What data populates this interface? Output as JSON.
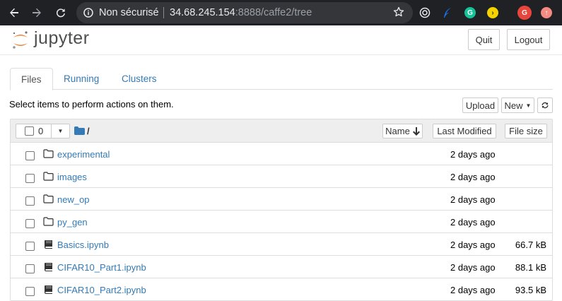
{
  "browser": {
    "security_label": "Non sécurisé",
    "url_host": "34.68.245.154",
    "url_rest": ":8888/caffe2/tree",
    "extensions": [
      {
        "name": "lens-icon",
        "color": "#5f6368",
        "text": ""
      },
      {
        "name": "feather-icon",
        "color": "#1a73e8",
        "text": ""
      },
      {
        "name": "grammarly-icon",
        "color": "#15c39a",
        "text": "G"
      },
      {
        "name": "yellow-ext-icon",
        "color": "#f4d300",
        "text": "›"
      },
      {
        "name": "profile-avatar",
        "color": "#e8453c",
        "text": "G"
      },
      {
        "name": "update-icon",
        "color": "#f28b82",
        "text": "↑"
      }
    ]
  },
  "header": {
    "logo_text": "jupyter",
    "quit_label": "Quit",
    "logout_label": "Logout"
  },
  "tabs": [
    {
      "label": "Files",
      "active": true
    },
    {
      "label": "Running",
      "active": false
    },
    {
      "label": "Clusters",
      "active": false
    }
  ],
  "toolbar": {
    "message": "Select items to perform actions on them.",
    "upload_label": "Upload",
    "new_label": "New"
  },
  "list_header": {
    "selected_count": "0",
    "path": "/",
    "name_label": "Name",
    "last_modified_label": "Last Modified",
    "file_size_label": "File size"
  },
  "files": [
    {
      "name": "experimental",
      "type": "folder",
      "modified": "2 days ago",
      "size": ""
    },
    {
      "name": "images",
      "type": "folder",
      "modified": "2 days ago",
      "size": ""
    },
    {
      "name": "new_op",
      "type": "folder",
      "modified": "2 days ago",
      "size": ""
    },
    {
      "name": "py_gen",
      "type": "folder",
      "modified": "2 days ago",
      "size": ""
    },
    {
      "name": "Basics.ipynb",
      "type": "notebook",
      "modified": "2 days ago",
      "size": "66.7 kB"
    },
    {
      "name": "CIFAR10_Part1.ipynb",
      "type": "notebook",
      "modified": "2 days ago",
      "size": "88.1 kB"
    },
    {
      "name": "CIFAR10_Part2.ipynb",
      "type": "notebook",
      "modified": "2 days ago",
      "size": "93.5 kB"
    }
  ],
  "colors": {
    "link": "#337ab7",
    "jupyter_orange": "#f37726",
    "chrome_bg": "#202124"
  }
}
